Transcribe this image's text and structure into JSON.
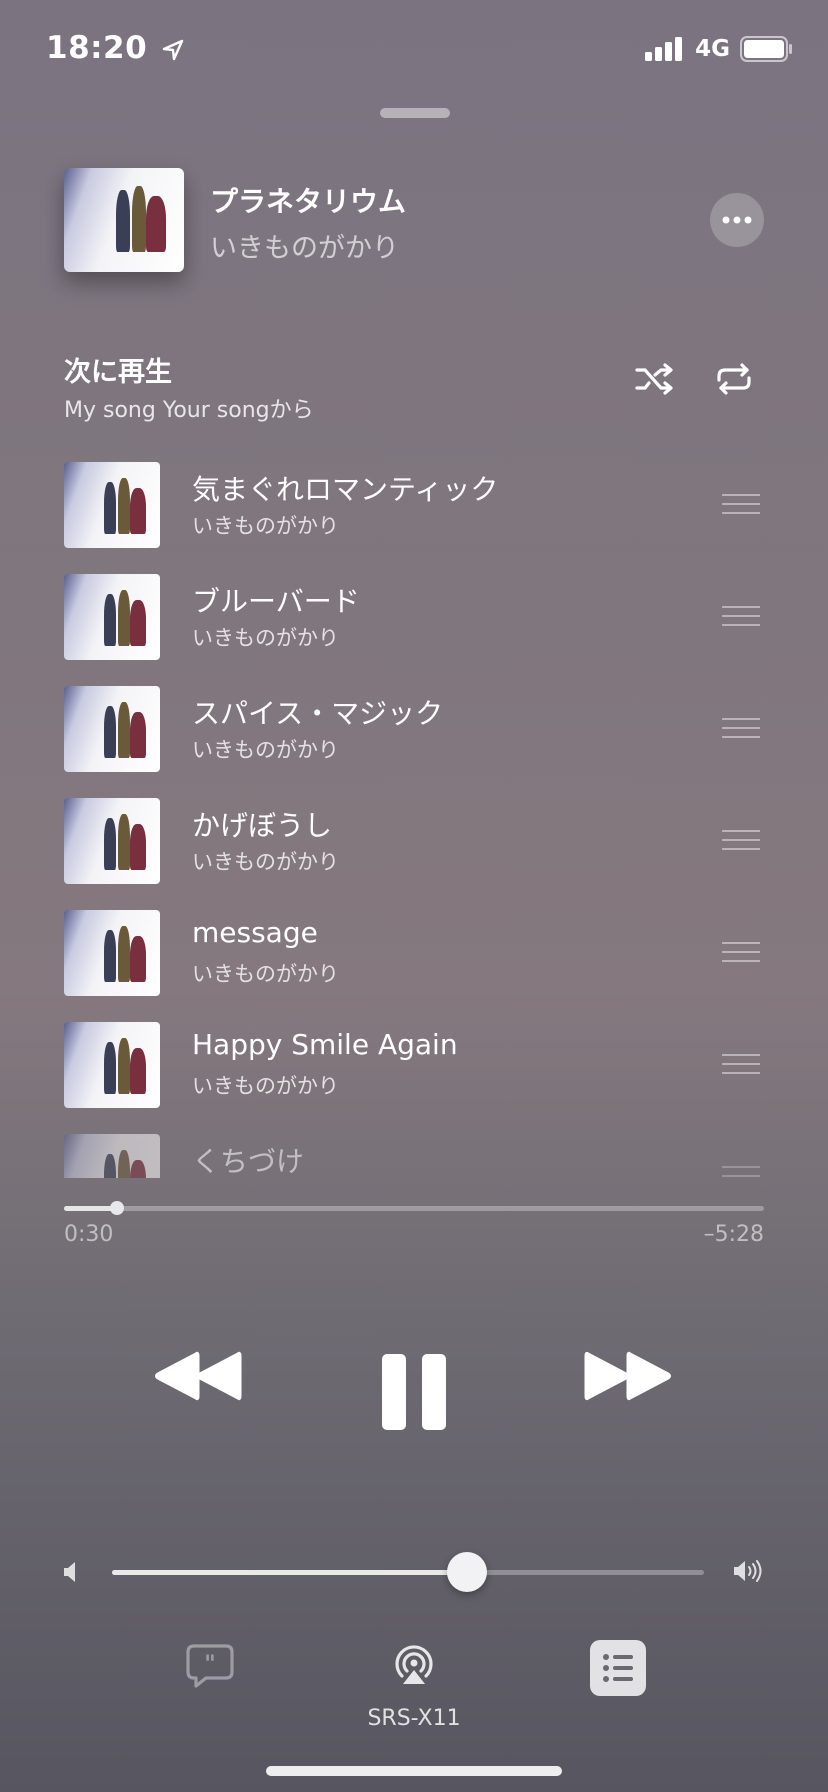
{
  "status": {
    "time": "18:20",
    "network": "4G"
  },
  "now_playing": {
    "title": "プラネタリウム",
    "artist": "いきものがかり"
  },
  "up_next": {
    "heading": "次に再生",
    "source": "My song Your songから"
  },
  "queue": [
    {
      "title": "気まぐれロマンティック",
      "artist": "いきものがかり"
    },
    {
      "title": "ブルーバード",
      "artist": "いきものがかり"
    },
    {
      "title": "スパイス・マジック",
      "artist": "いきものがかり"
    },
    {
      "title": "かげぼうし",
      "artist": "いきものがかり"
    },
    {
      "title": "message",
      "artist": "いきものがかり"
    },
    {
      "title": "Happy Smile Again",
      "artist": "いきものがかり"
    },
    {
      "title": "くちづけ",
      "artist": ""
    }
  ],
  "playback": {
    "elapsed": "0:30",
    "remaining": "–5:28",
    "progress_fraction": 0.076,
    "state": "playing"
  },
  "volume": {
    "level_fraction": 0.6
  },
  "bottom": {
    "airplay_device": "SRS-X11"
  },
  "icons": {
    "shuffle": "shuffle-icon",
    "repeat": "repeat-icon",
    "more": "more-icon",
    "rewind": "rewind-icon",
    "pause": "pause-icon",
    "forward": "fast-forward-icon",
    "lyrics": "lyrics-icon",
    "airplay": "airplay-icon",
    "queue": "queue-list-icon"
  }
}
